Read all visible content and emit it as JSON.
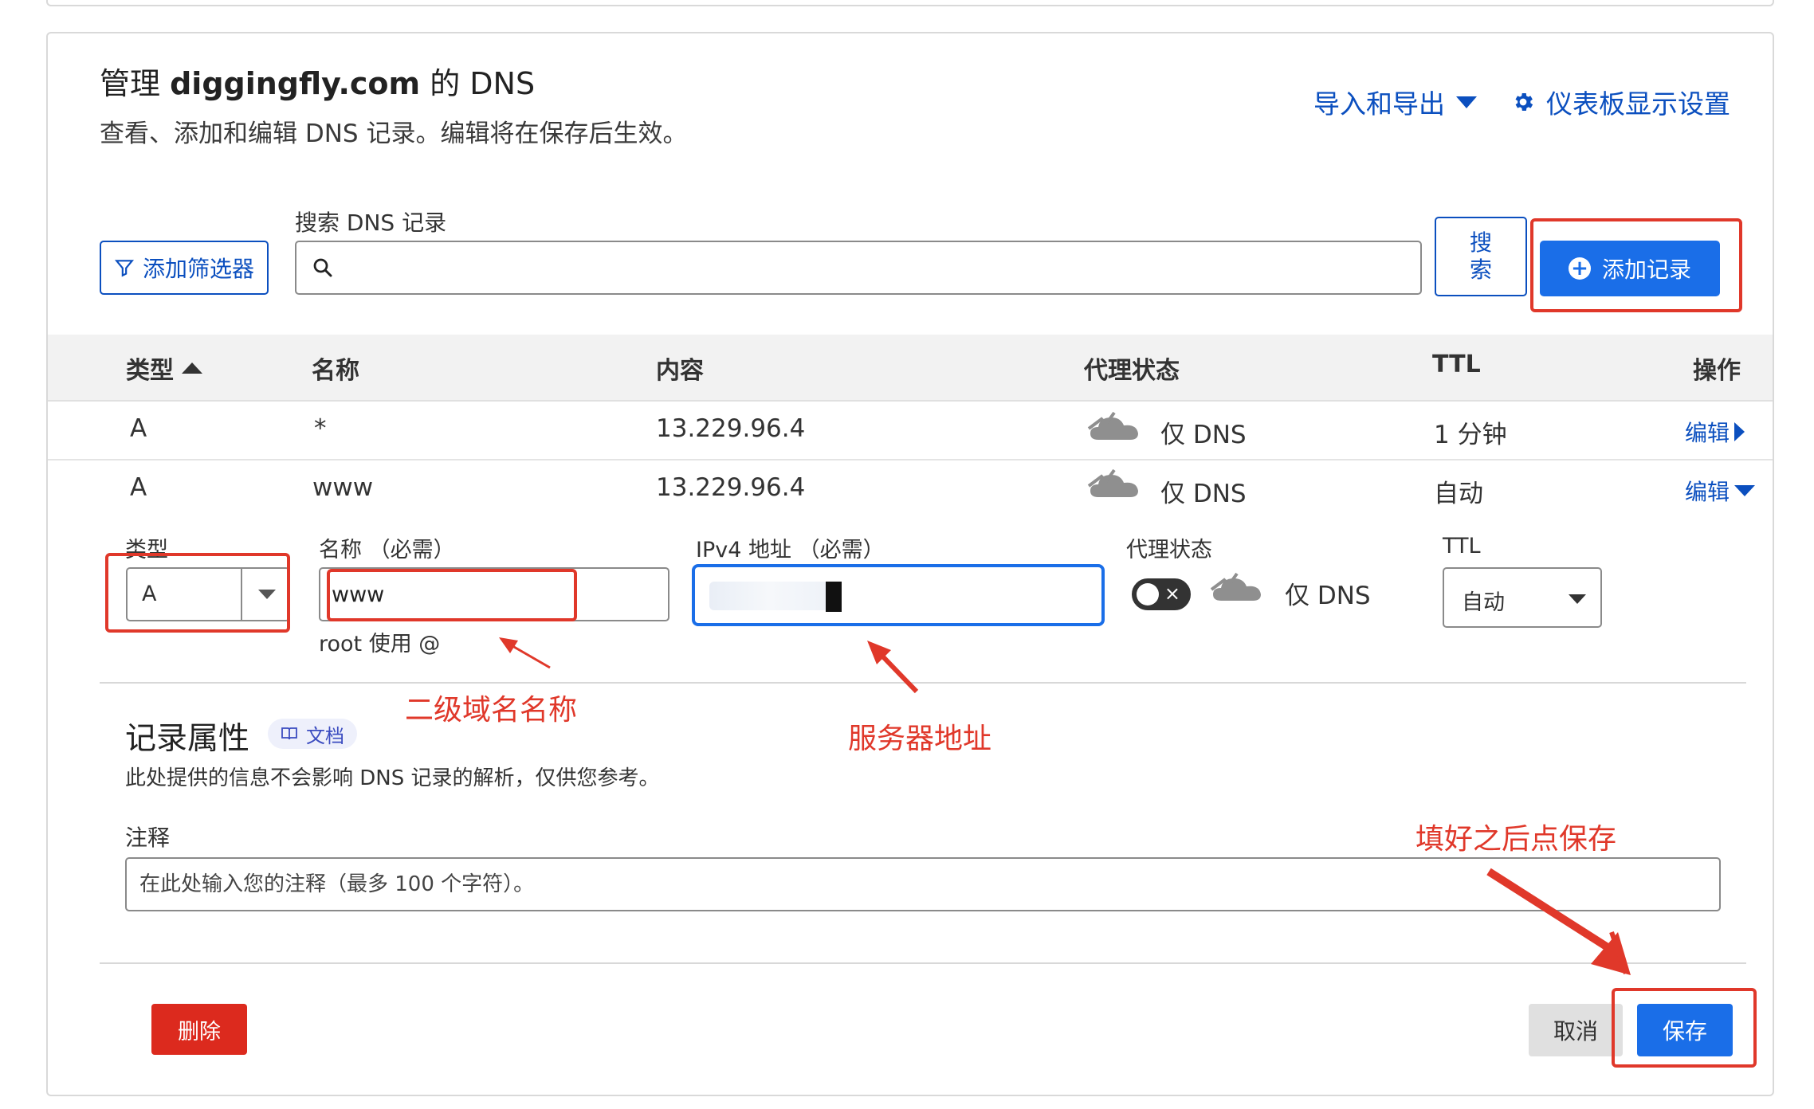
{
  "header": {
    "title_prefix": "管理 ",
    "domain": "diggingfly.com",
    "title_suffix": " 的 DNS",
    "subtitle": "查看、添加和编辑 DNS 记录。编辑将在保存后生效。",
    "import_export_label": "导入和导出",
    "dashboard_settings_label": "仪表板显示设置"
  },
  "toolbar": {
    "filter_label": "添加筛选器",
    "search_label": "搜索 DNS 记录",
    "search_value": "",
    "search_button_label": "搜索",
    "add_record_label": "添加记录"
  },
  "table": {
    "headers": {
      "type": "类型",
      "name": "名称",
      "content": "内容",
      "proxy": "代理状态",
      "ttl": "TTL",
      "actions": "操作"
    },
    "rows": [
      {
        "type": "A",
        "name": "*",
        "content": "13.229.96.4",
        "proxy": "仅 DNS",
        "ttl": "1 分钟",
        "action": "编辑"
      },
      {
        "type": "A",
        "name": "www",
        "content": "13.229.96.4",
        "proxy": "仅 DNS",
        "ttl": "自动",
        "action": "编辑"
      }
    ]
  },
  "edit_form": {
    "type_label": "类型",
    "type_value": "A",
    "name_label": "名称 （必需）",
    "name_value": "www",
    "name_hint": "root 使用 @",
    "ip_label": "IPv4 地址 （必需）",
    "proxy_label": "代理状态",
    "proxy_value": "仅 DNS",
    "ttl_label": "TTL",
    "ttl_value": "自动"
  },
  "attributes": {
    "title": "记录属性",
    "doc_badge": "文档",
    "description": "此处提供的信息不会影响 DNS 记录的解析，仅供您参考。",
    "note_label": "注释",
    "note_placeholder": "在此处输入您的注释（最多 100 个字符）。"
  },
  "footer": {
    "delete_label": "删除",
    "cancel_label": "取消",
    "save_label": "保存"
  },
  "annotations": {
    "subdomain": "二级域名名称",
    "server_address": "服务器地址",
    "save_hint": "填好之后点保存"
  },
  "colors": {
    "accent_blue": "#1a6ee8",
    "link_blue": "#0b4fbf",
    "danger_red": "#dc2a1e",
    "annotation_red": "#e0382a"
  }
}
